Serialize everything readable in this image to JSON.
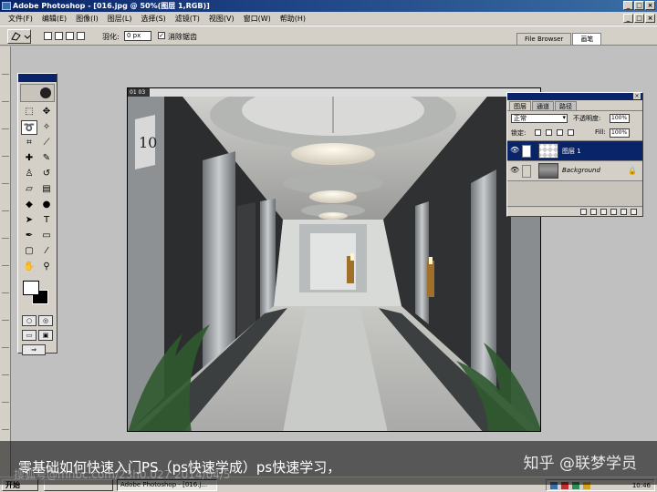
{
  "window": {
    "title": "Adobe Photoshop - [016.jpg @ 50%(图层 1,RGB)]"
  },
  "menu": [
    "文件(F)",
    "编辑(E)",
    "图像(I)",
    "图层(L)",
    "选择(S)",
    "滤镜(T)",
    "视图(V)",
    "窗口(W)",
    "帮助(H)"
  ],
  "options": {
    "feather_label": "羽化:",
    "feather_value": "0 px",
    "antialias_label": "消除锯齿",
    "antialias_checked": "✓"
  },
  "palette_well": [
    "File Browser",
    "画笔"
  ],
  "document": {
    "ruler_corner": "01 03",
    "sign_number": "10"
  },
  "layers_palette": {
    "tabs": [
      "图层",
      "通道",
      "路径"
    ],
    "blend_mode": "正常",
    "opacity_label": "不透明度:",
    "opacity_value": "100%",
    "lock_label": "锁定:",
    "fill_label": "Fill:",
    "fill_value": "100%",
    "layers": [
      {
        "name": "图层 1",
        "selected": true
      },
      {
        "name": "Background",
        "selected": false
      }
    ]
  },
  "taskbar": {
    "start": "开始",
    "task_label": "Adobe Photoshop - [016.j...",
    "clock": "10:46"
  },
  "overlay": {
    "caption": "零基础如何快速入门PS（ps快速学成）ps快速学习，",
    "watermark_left": "搜狐号@mhbc.com/23h0.027 2014/04/5",
    "watermark_right": "知乎 @联梦学员"
  },
  "colors": {
    "title_bar": "#0a246a",
    "chrome": "#d4d0c8",
    "selection": "#0a246a"
  }
}
